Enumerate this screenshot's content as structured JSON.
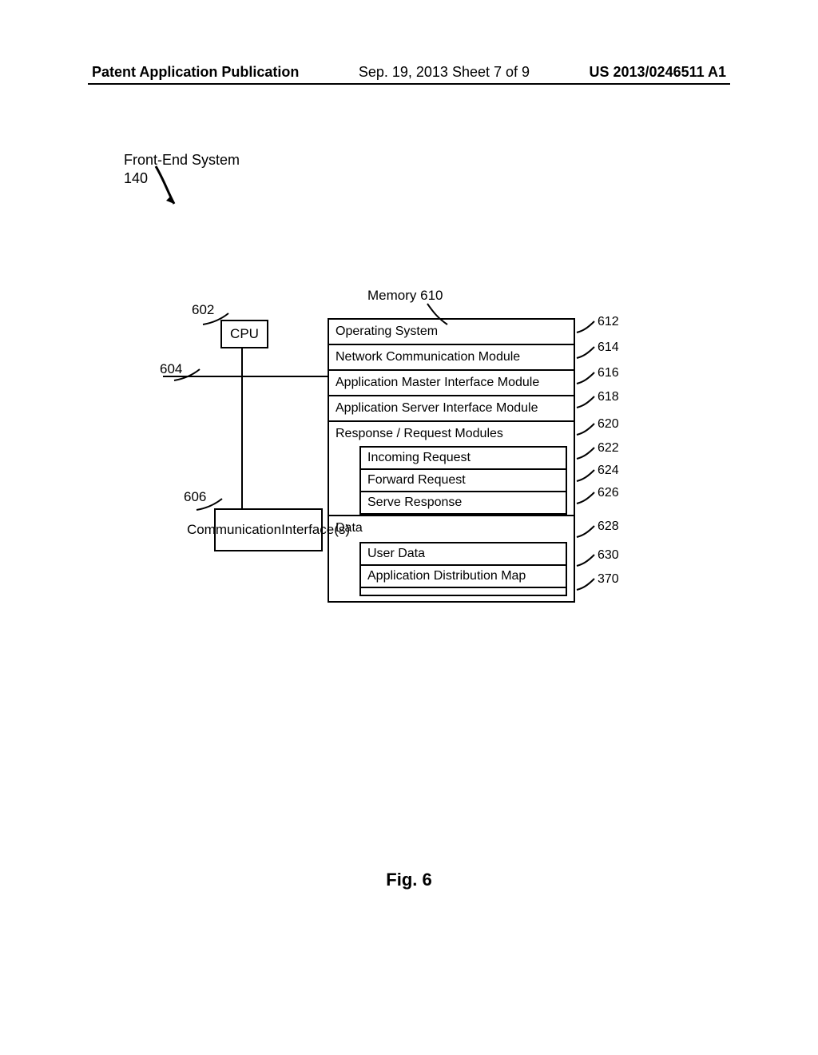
{
  "header": {
    "left": "Patent Application Publication",
    "mid": "Sep. 19, 2013  Sheet 7 of 9",
    "right": "US 2013/0246511 A1"
  },
  "title": {
    "label": "Front-End System",
    "num": "140"
  },
  "cpu": {
    "num": "602",
    "label": "CPU"
  },
  "bus": {
    "num": "604"
  },
  "comm": {
    "num": "606",
    "label1": "Communication",
    "label2": "Interface(s)"
  },
  "memory": {
    "title": "Memory 610",
    "rows": {
      "os": {
        "label": "Operating System",
        "ref": "612"
      },
      "ncm": {
        "label": "Network Communication Module",
        "ref": "614"
      },
      "amim": {
        "label": "Application Master Interface Module",
        "ref": "616"
      },
      "asim": {
        "label": "Application Server Interface Module",
        "ref": "618"
      },
      "rrm": {
        "label": "Response / Request Modules",
        "ref": "620",
        "sub": {
          "inc": {
            "label": "Incoming Request",
            "ref": "622"
          },
          "fwd": {
            "label": "Forward Request",
            "ref": "624"
          },
          "srv": {
            "label": "Serve Response",
            "ref": "626"
          }
        }
      },
      "data": {
        "label": "Data",
        "ref": "628",
        "sub": {
          "ud": {
            "label": "User Data",
            "ref": "630"
          },
          "adm": {
            "label": "Application Distribution Map",
            "ref": "370"
          }
        }
      }
    }
  },
  "figure_caption": "Fig. 6"
}
